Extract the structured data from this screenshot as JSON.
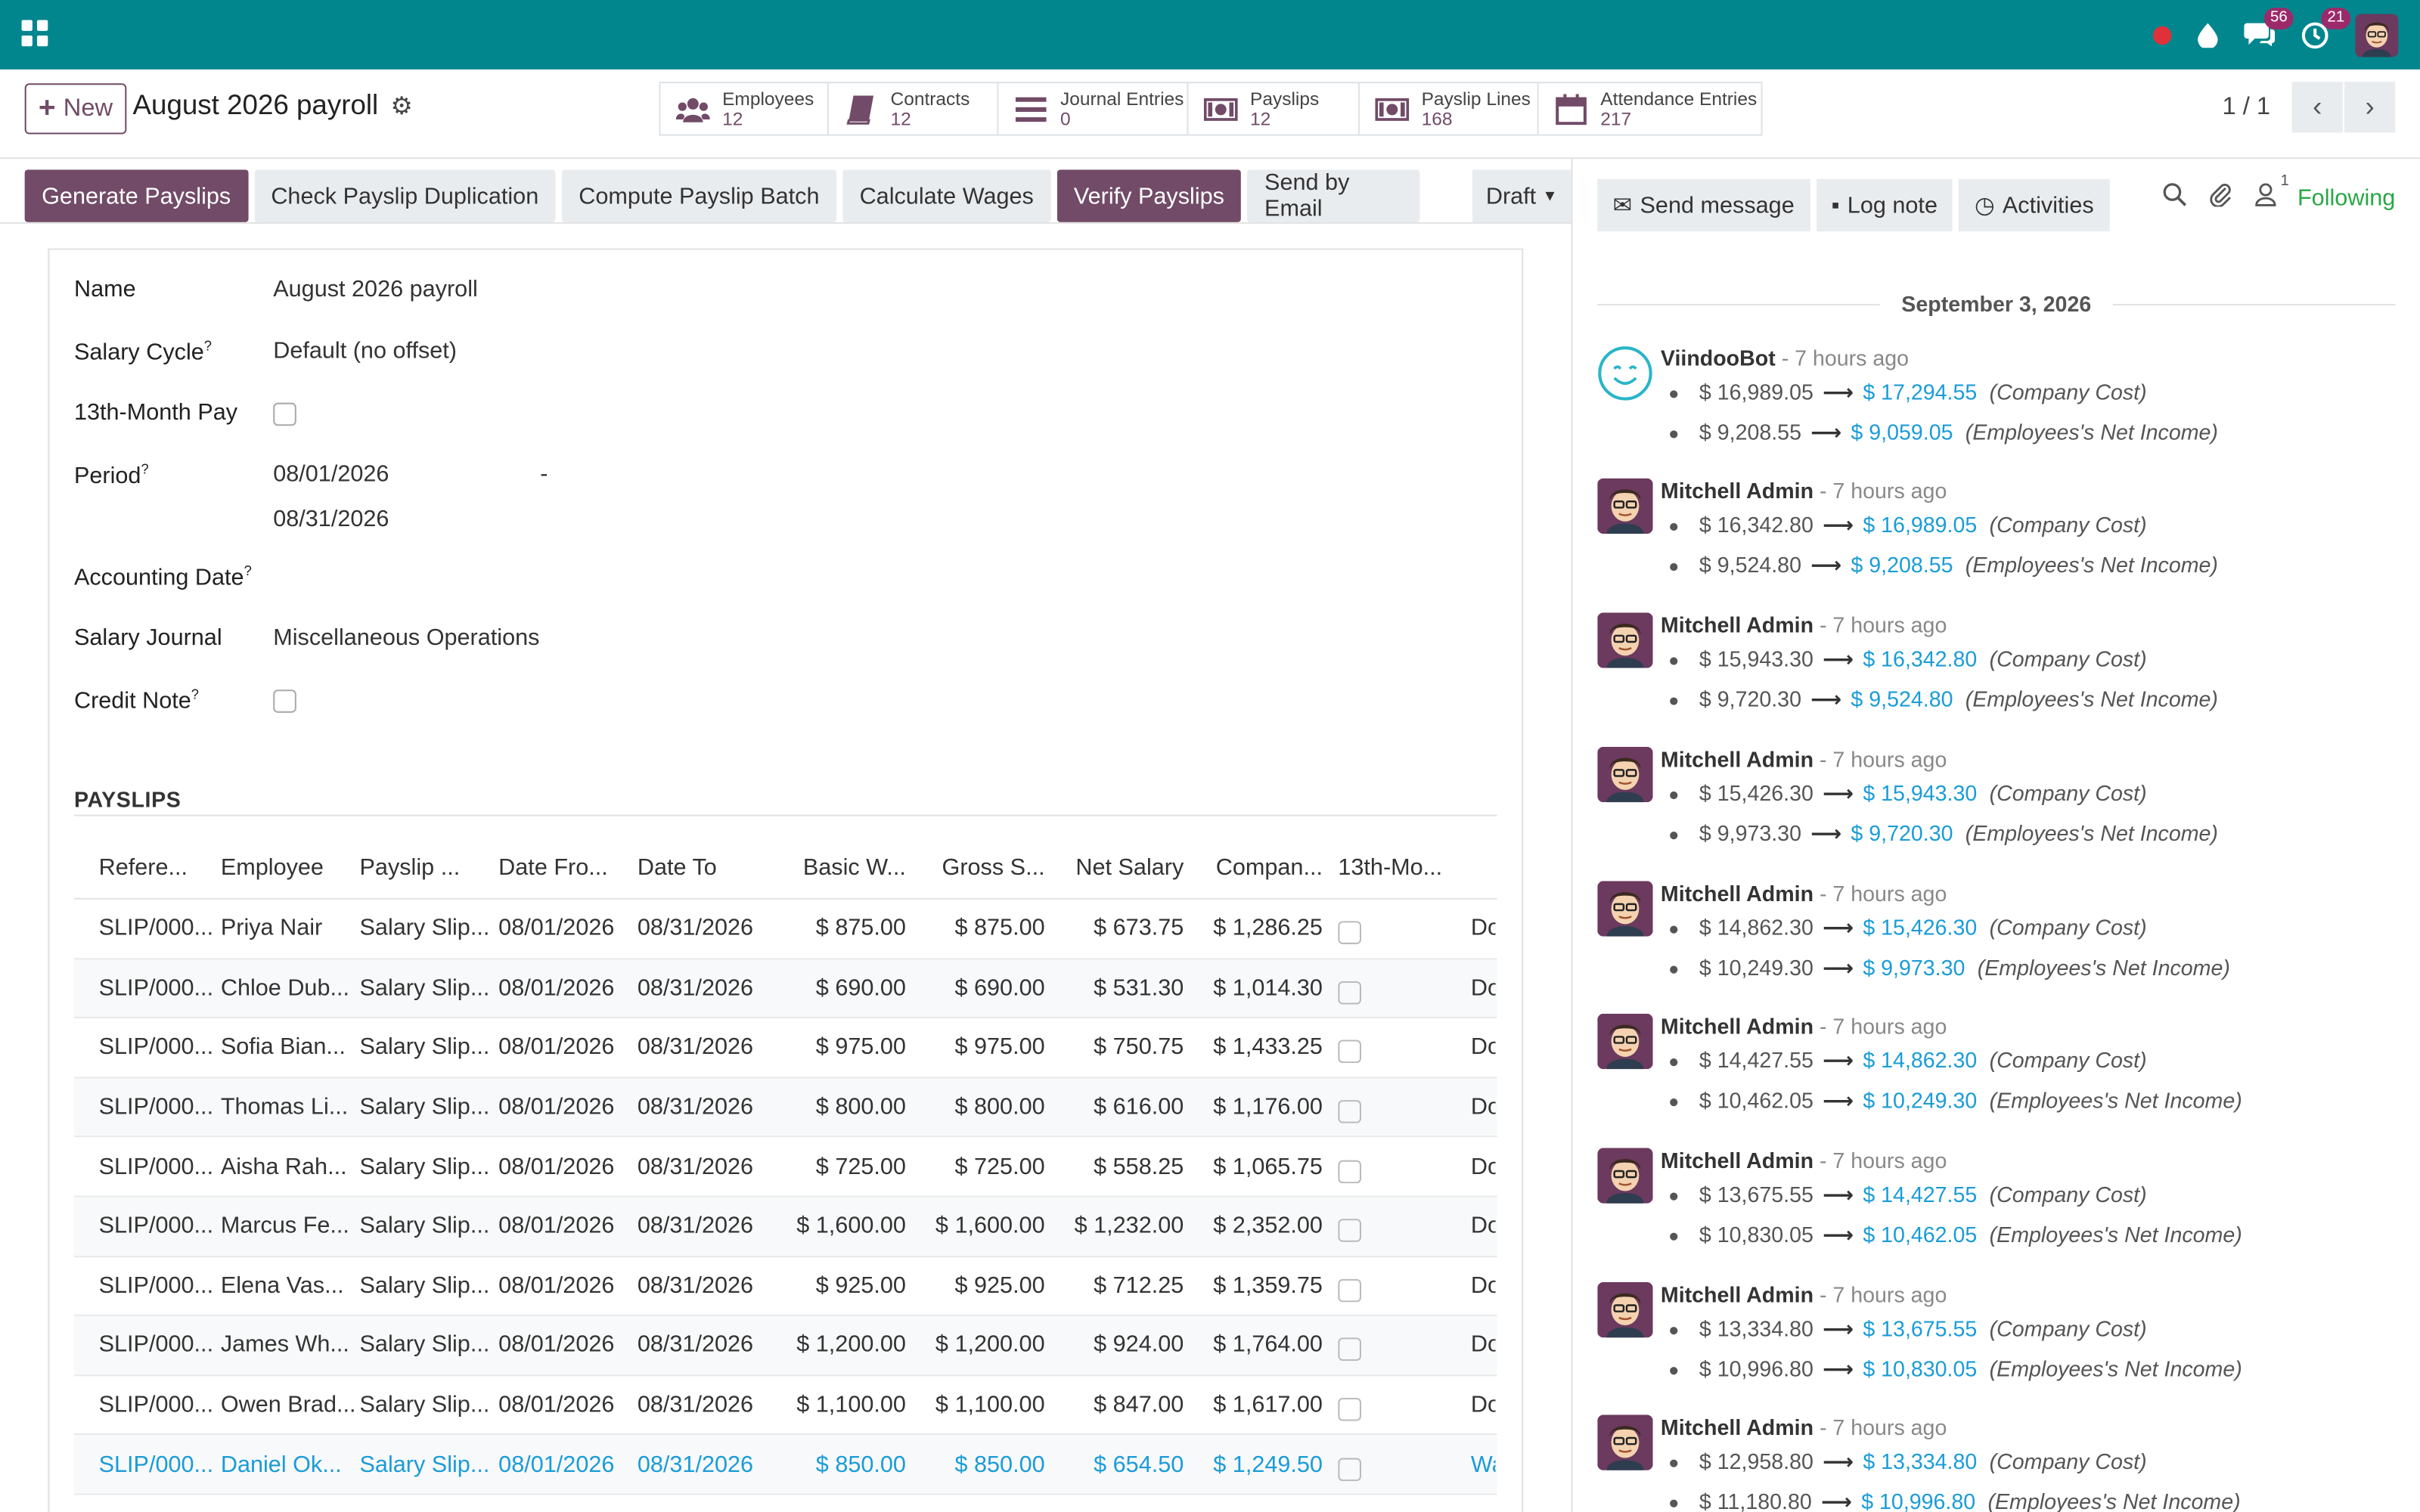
{
  "topbar": {
    "chat_count": "56",
    "activity_count": "21"
  },
  "control": {
    "new_label": "New",
    "title": "August 2026 payroll",
    "pager": "1 / 1"
  },
  "smart_buttons": [
    {
      "label": "Employees",
      "value": "12"
    },
    {
      "label": "Contracts",
      "value": "12"
    },
    {
      "label": "Journal Entries",
      "value": "0"
    },
    {
      "label": "Payslips",
      "value": "12"
    },
    {
      "label": "Payslip Lines",
      "value": "168"
    },
    {
      "label": "Attendance Entries",
      "value": "217"
    }
  ],
  "actions": [
    "Generate Payslips",
    "Check Payslip Duplication",
    "Compute Payslip Batch",
    "Calculate Wages",
    "Verify Payslips",
    "Send by Email"
  ],
  "status": "Draft",
  "form": {
    "name_label": "Name",
    "name_value": "August 2026 payroll",
    "salary_cycle_label": "Salary Cycle",
    "salary_cycle_value": "Default (no offset)",
    "thirteenth_label": "13th-Month Pay",
    "period_label": "Period",
    "period_from": "08/01/2026",
    "period_sep": "-",
    "period_to": "08/31/2026",
    "accounting_date_label": "Accounting Date",
    "journal_label": "Salary Journal",
    "journal_value": "Miscellaneous Operations",
    "credit_note_label": "Credit Note",
    "help_mark": "?"
  },
  "payslips": {
    "section_title": "PAYSLIPS",
    "columns": [
      "Refere...",
      "Employee",
      "Payslip ...",
      "Date Fro...",
      "Date To",
      "Basic W...",
      "Gross S...",
      "Net Salary",
      "Compan...",
      "13th-Mo..."
    ],
    "rows": [
      {
        "ref": "SLIP/000...",
        "emp": "Priya Nair",
        "ps": "Salary Slip...",
        "df": "08/01/2026",
        "dt": "08/31/2026",
        "bw": "$ 875.00",
        "gs": "$ 875.00",
        "ns": "$ 673.75",
        "co": "$ 1,286.25",
        "st": "Do"
      },
      {
        "ref": "SLIP/000...",
        "emp": "Chloe Dub...",
        "ps": "Salary Slip...",
        "df": "08/01/2026",
        "dt": "08/31/2026",
        "bw": "$ 690.00",
        "gs": "$ 690.00",
        "ns": "$ 531.30",
        "co": "$ 1,014.30",
        "st": "Do"
      },
      {
        "ref": "SLIP/000...",
        "emp": "Sofia Bian...",
        "ps": "Salary Slip...",
        "df": "08/01/2026",
        "dt": "08/31/2026",
        "bw": "$ 975.00",
        "gs": "$ 975.00",
        "ns": "$ 750.75",
        "co": "$ 1,433.25",
        "st": "Do"
      },
      {
        "ref": "SLIP/000...",
        "emp": "Thomas Li...",
        "ps": "Salary Slip...",
        "df": "08/01/2026",
        "dt": "08/31/2026",
        "bw": "$ 800.00",
        "gs": "$ 800.00",
        "ns": "$ 616.00",
        "co": "$ 1,176.00",
        "st": "Do"
      },
      {
        "ref": "SLIP/000...",
        "emp": "Aisha Rah...",
        "ps": "Salary Slip...",
        "df": "08/01/2026",
        "dt": "08/31/2026",
        "bw": "$ 725.00",
        "gs": "$ 725.00",
        "ns": "$ 558.25",
        "co": "$ 1,065.75",
        "st": "Do"
      },
      {
        "ref": "SLIP/000...",
        "emp": "Marcus Fe...",
        "ps": "Salary Slip...",
        "df": "08/01/2026",
        "dt": "08/31/2026",
        "bw": "$ 1,600.00",
        "gs": "$ 1,600.00",
        "ns": "$ 1,232.00",
        "co": "$ 2,352.00",
        "st": "Do"
      },
      {
        "ref": "SLIP/000...",
        "emp": "Elena Vas...",
        "ps": "Salary Slip...",
        "df": "08/01/2026",
        "dt": "08/31/2026",
        "bw": "$ 925.00",
        "gs": "$ 925.00",
        "ns": "$ 712.25",
        "co": "$ 1,359.75",
        "st": "Do"
      },
      {
        "ref": "SLIP/000...",
        "emp": "James Wh...",
        "ps": "Salary Slip...",
        "df": "08/01/2026",
        "dt": "08/31/2026",
        "bw": "$ 1,200.00",
        "gs": "$ 1,200.00",
        "ns": "$ 924.00",
        "co": "$ 1,764.00",
        "st": "Do"
      },
      {
        "ref": "SLIP/000...",
        "emp": "Owen Brad...",
        "ps": "Salary Slip...",
        "df": "08/01/2026",
        "dt": "08/31/2026",
        "bw": "$ 1,100.00",
        "gs": "$ 1,100.00",
        "ns": "$ 847.00",
        "co": "$ 1,617.00",
        "st": "Do"
      },
      {
        "ref": "SLIP/000...",
        "emp": "Daniel Ok...",
        "ps": "Salary Slip...",
        "df": "08/01/2026",
        "dt": "08/31/2026",
        "bw": "$ 850.00",
        "gs": "$ 850.00",
        "ns": "$ 654.50",
        "co": "$ 1,249.50",
        "st": "Wa"
      }
    ]
  },
  "chatter": {
    "send_message": "Send message",
    "log_note": "Log note",
    "activities": "Activities",
    "follower_count": "1",
    "following": "Following",
    "date": "September 3, 2026",
    "messages": [
      {
        "author": "ViindooBot",
        "time": "- 7 hours ago",
        "lines": [
          {
            "old": "$ 16,989.05",
            "new": "$ 17,294.55",
            "field": "(Company Cost)"
          },
          {
            "old": "$ 9,208.55",
            "new": "$ 9,059.05",
            "field": "(Employees's Net Income)"
          }
        ]
      },
      {
        "author": "Mitchell Admin",
        "time": "- 7 hours ago",
        "lines": [
          {
            "old": "$ 16,342.80",
            "new": "$ 16,989.05",
            "field": "(Company Cost)"
          },
          {
            "old": "$ 9,524.80",
            "new": "$ 9,208.55",
            "field": "(Employees's Net Income)"
          }
        ]
      },
      {
        "author": "Mitchell Admin",
        "time": "- 7 hours ago",
        "lines": [
          {
            "old": "$ 15,943.30",
            "new": "$ 16,342.80",
            "field": "(Company Cost)"
          },
          {
            "old": "$ 9,720.30",
            "new": "$ 9,524.80",
            "field": "(Employees's Net Income)"
          }
        ]
      },
      {
        "author": "Mitchell Admin",
        "time": "- 7 hours ago",
        "lines": [
          {
            "old": "$ 15,426.30",
            "new": "$ 15,943.30",
            "field": "(Company Cost)"
          },
          {
            "old": "$ 9,973.30",
            "new": "$ 9,720.30",
            "field": "(Employees's Net Income)"
          }
        ]
      },
      {
        "author": "Mitchell Admin",
        "time": "- 7 hours ago",
        "lines": [
          {
            "old": "$ 14,862.30",
            "new": "$ 15,426.30",
            "field": "(Company Cost)"
          },
          {
            "old": "$ 10,249.30",
            "new": "$ 9,973.30",
            "field": "(Employees's Net Income)"
          }
        ]
      },
      {
        "author": "Mitchell Admin",
        "time": "- 7 hours ago",
        "lines": [
          {
            "old": "$ 14,427.55",
            "new": "$ 14,862.30",
            "field": "(Company Cost)"
          },
          {
            "old": "$ 10,462.05",
            "new": "$ 10,249.30",
            "field": "(Employees's Net Income)"
          }
        ]
      },
      {
        "author": "Mitchell Admin",
        "time": "- 7 hours ago",
        "lines": [
          {
            "old": "$ 13,675.55",
            "new": "$ 14,427.55",
            "field": "(Company Cost)"
          },
          {
            "old": "$ 10,830.05",
            "new": "$ 10,462.05",
            "field": "(Employees's Net Income)"
          }
        ]
      },
      {
        "author": "Mitchell Admin",
        "time": "- 7 hours ago",
        "lines": [
          {
            "old": "$ 13,334.80",
            "new": "$ 13,675.55",
            "field": "(Company Cost)"
          },
          {
            "old": "$ 10,996.80",
            "new": "$ 10,830.05",
            "field": "(Employees's Net Income)"
          }
        ]
      },
      {
        "author": "Mitchell Admin",
        "time": "- 7 hours ago",
        "lines": [
          {
            "old": "$ 12,958.80",
            "new": "$ 13,334.80",
            "field": "(Company Cost)"
          },
          {
            "old": "$ 11,180.80",
            "new": "$ 10,996.80",
            "field": "(Employees's Net Income)"
          }
        ]
      }
    ]
  },
  "colors": {
    "topbar": "#01868e",
    "primary": "#714b67",
    "link": "#1a9cd8",
    "following": "#28a745"
  }
}
